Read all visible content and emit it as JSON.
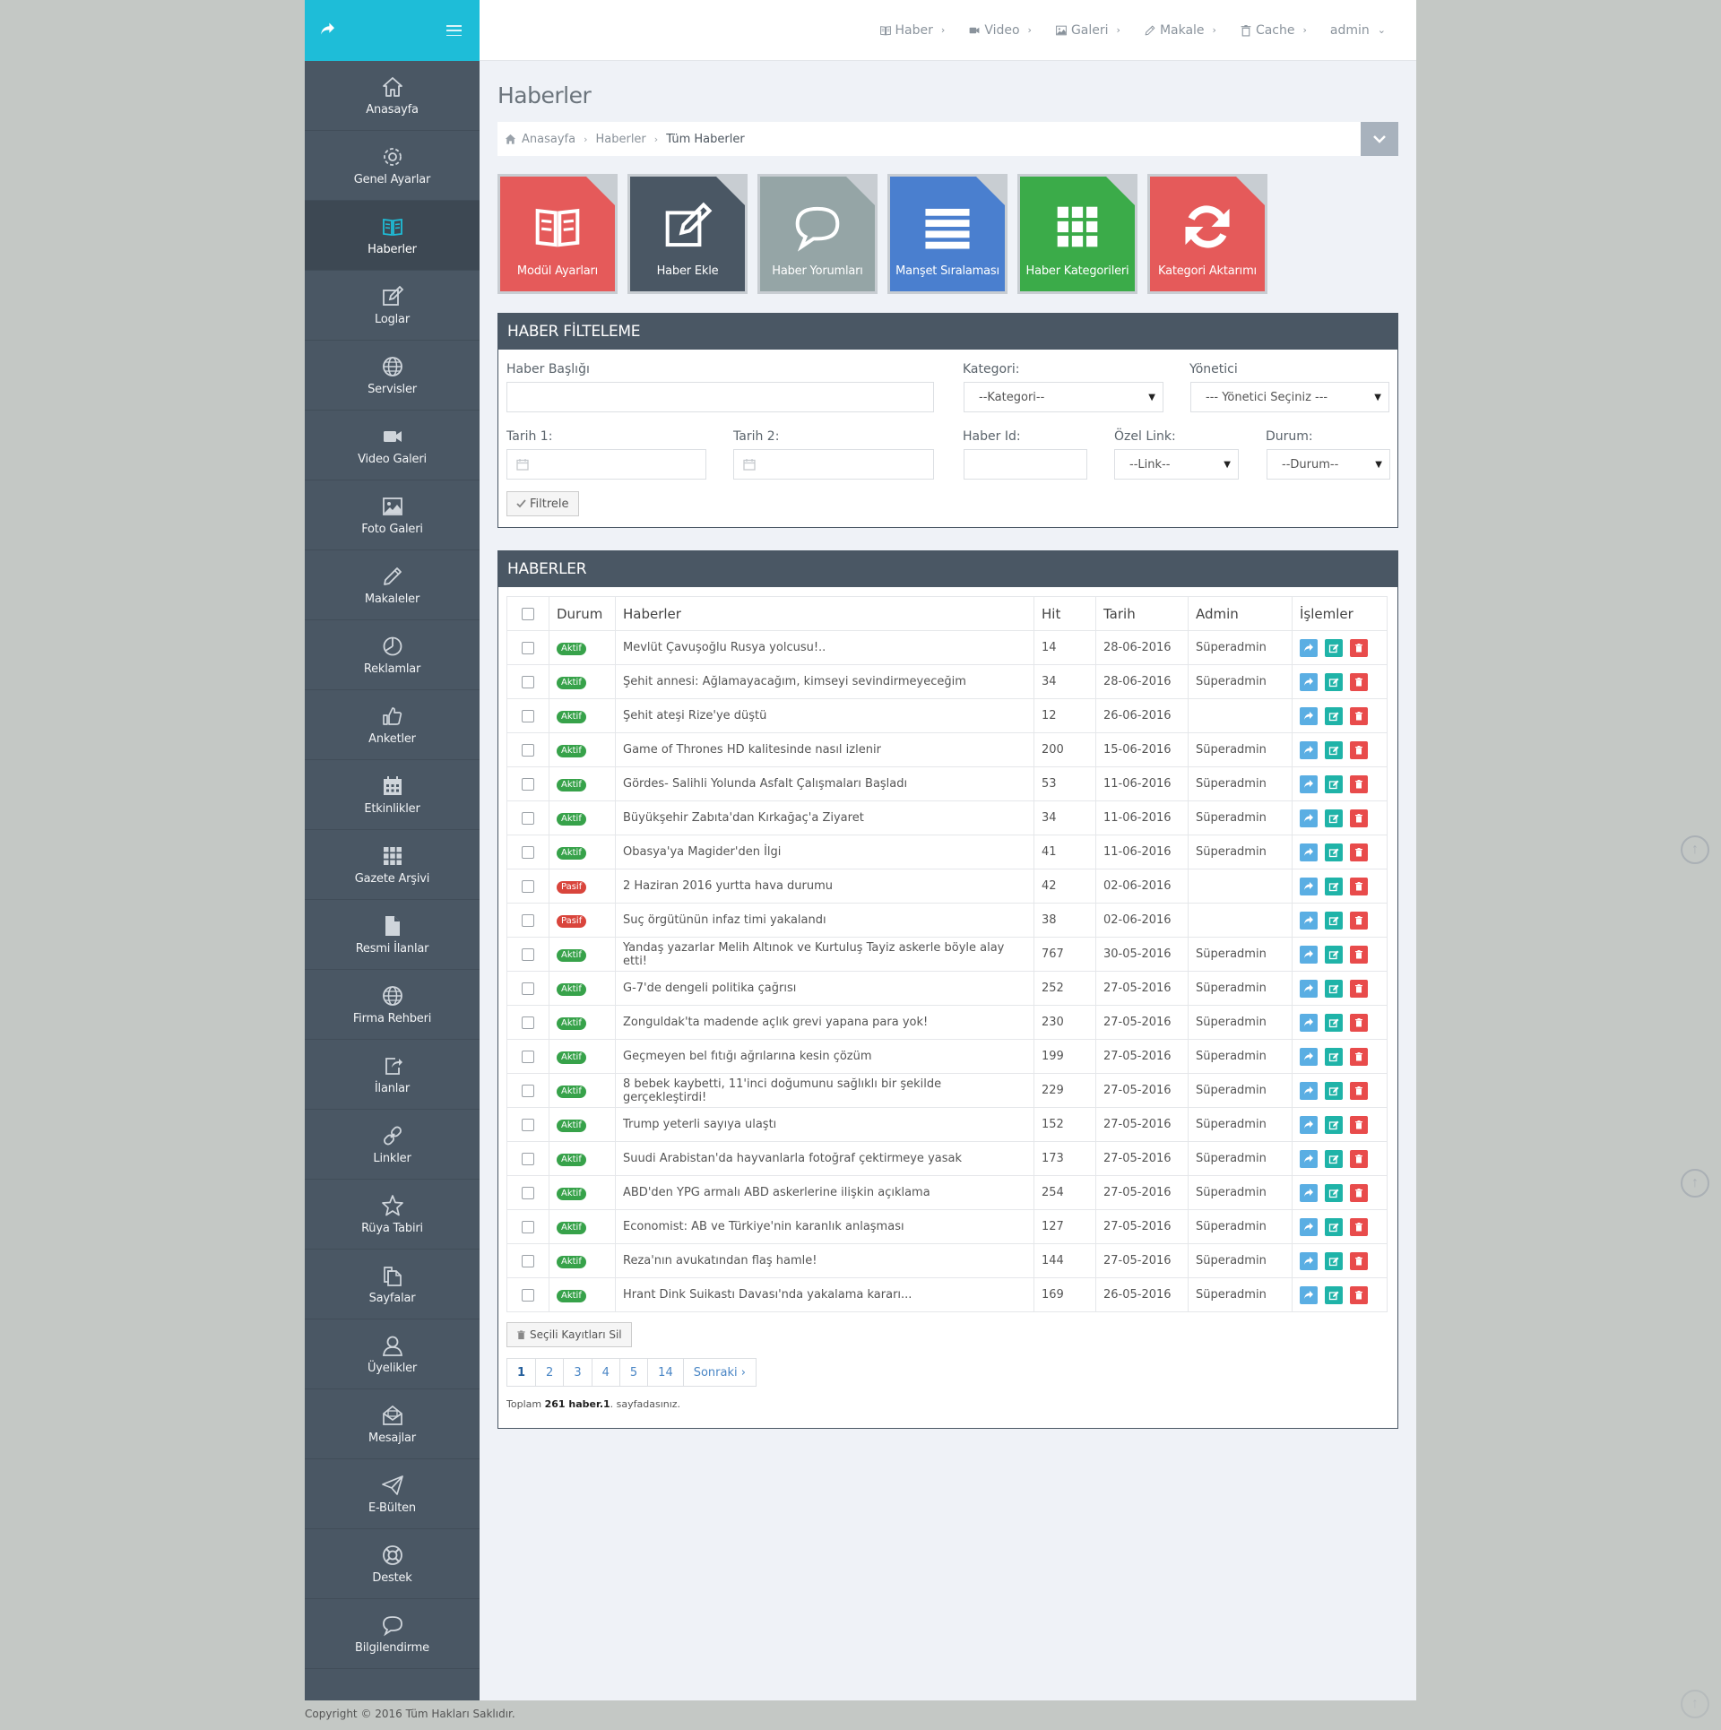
{
  "sidebar": {
    "items": [
      {
        "label": "Anasayfa",
        "icon": "home-icon"
      },
      {
        "label": "Genel Ayarlar",
        "icon": "gear-icon"
      },
      {
        "label": "Haberler",
        "icon": "book-icon"
      },
      {
        "label": "Loglar",
        "icon": "edit-icon"
      },
      {
        "label": "Servisler",
        "icon": "globe-icon"
      },
      {
        "label": "Video Galeri",
        "icon": "video-icon"
      },
      {
        "label": "Foto Galeri",
        "icon": "picture-icon"
      },
      {
        "label": "Makaleler",
        "icon": "pencil-icon"
      },
      {
        "label": "Reklamlar",
        "icon": "pie-chart-icon"
      },
      {
        "label": "Anketler",
        "icon": "thumbs-up-icon"
      },
      {
        "label": "Etkinlikler",
        "icon": "calendar-icon"
      },
      {
        "label": "Gazete Arşivi",
        "icon": "grid-icon"
      },
      {
        "label": "Resmi İlanlar",
        "icon": "file-icon"
      },
      {
        "label": "Firma Rehberi",
        "icon": "globe-icon"
      },
      {
        "label": "İlanlar",
        "icon": "share-square-icon"
      },
      {
        "label": "Linkler",
        "icon": "link-icon"
      },
      {
        "label": "Rüya Tabiri",
        "icon": "star-icon"
      },
      {
        "label": "Sayfalar",
        "icon": "copy-icon"
      },
      {
        "label": "Üyelikler",
        "icon": "user-icon"
      },
      {
        "label": "Mesajlar",
        "icon": "envelope-icon"
      },
      {
        "label": "E-Bülten",
        "icon": "paper-plane-icon"
      },
      {
        "label": "Destek",
        "icon": "life-ring-icon"
      },
      {
        "label": "Bilgilendirme",
        "icon": "comment-icon"
      }
    ],
    "active_index": 2
  },
  "topnav": {
    "items": [
      {
        "label": "Haber",
        "icon": "book-icon"
      },
      {
        "label": "Video",
        "icon": "video-icon"
      },
      {
        "label": "Galeri",
        "icon": "picture-icon"
      },
      {
        "label": "Makale",
        "icon": "pencil-icon"
      },
      {
        "label": "Cache",
        "icon": "trash-icon"
      }
    ],
    "user": "admin"
  },
  "page": {
    "title": "Haberler",
    "breadcrumb": [
      "Anasayfa",
      "Haberler",
      "Tüm Haberler"
    ]
  },
  "tiles": [
    {
      "label": "Modül Ayarları",
      "color": "#e55a5a",
      "icon": "book-icon"
    },
    {
      "label": "Haber Ekle",
      "color": "#4a5764",
      "icon": "edit-icon"
    },
    {
      "label": "Haber Yorumları",
      "color": "#95a5a6",
      "icon": "comment-icon"
    },
    {
      "label": "Manşet Sıralaması",
      "color": "#4a7fcf",
      "icon": "list-icon"
    },
    {
      "label": "Haber Kategorileri",
      "color": "#3bab49",
      "icon": "grid-icon"
    },
    {
      "label": "Kategori Aktarımı",
      "color": "#e55a5a",
      "icon": "refresh-icon"
    }
  ],
  "filter": {
    "title": "HABER FİLTELEME",
    "haber_basligi_label": "Haber Başlığı",
    "kategori_label": "Kategori:",
    "kategori_value": "--Kategori--",
    "yonetici_label": "Yönetici",
    "yonetici_value": "--- Yönetici Seçiniz ---",
    "tarih1_label": "Tarih 1:",
    "tarih2_label": "Tarih 2:",
    "haber_id_label": "Haber Id:",
    "ozel_link_label": "Özel Link:",
    "ozel_link_value": "--Link--",
    "durum_label": "Durum:",
    "durum_value": "--Durum--",
    "button": "Filtrele"
  },
  "list": {
    "title": "HABERLER",
    "columns": [
      "Durum",
      "Haberler",
      "Hit",
      "Tarih",
      "Admin",
      "İşlemler"
    ],
    "rows": [
      {
        "status": "Aktif",
        "title": "Mevlüt Çavuşoğlu Rusya yolcusu!..",
        "hit": "14",
        "date": "28-06-2016",
        "admin": "Süperadmin"
      },
      {
        "status": "Aktif",
        "title": "Şehit annesi: Ağlamayacağım, kimseyi sevindirmeyeceğim",
        "hit": "34",
        "date": "28-06-2016",
        "admin": "Süperadmin"
      },
      {
        "status": "Aktif",
        "title": "Şehit ateşi Rize'ye düştü",
        "hit": "12",
        "date": "26-06-2016",
        "admin": ""
      },
      {
        "status": "Aktif",
        "title": "Game of Thrones HD kalitesinde nasıl izlenir",
        "hit": "200",
        "date": "15-06-2016",
        "admin": "Süperadmin"
      },
      {
        "status": "Aktif",
        "title": "Gördes- Salihli Yolunda Asfalt Çalışmaları Başladı",
        "hit": "53",
        "date": "11-06-2016",
        "admin": "Süperadmin"
      },
      {
        "status": "Aktif",
        "title": "Büyükşehir Zabıta'dan Kırkağaç'a Ziyaret",
        "hit": "34",
        "date": "11-06-2016",
        "admin": "Süperadmin"
      },
      {
        "status": "Aktif",
        "title": "Obasya'ya Magider'den İlgi",
        "hit": "41",
        "date": "11-06-2016",
        "admin": "Süperadmin"
      },
      {
        "status": "Pasif",
        "title": "2 Haziran 2016 yurtta hava durumu",
        "hit": "42",
        "date": "02-06-2016",
        "admin": ""
      },
      {
        "status": "Pasif",
        "title": "Suç örgütünün infaz timi yakalandı",
        "hit": "38",
        "date": "02-06-2016",
        "admin": ""
      },
      {
        "status": "Aktif",
        "title": "Yandaş yazarlar Melih Altınok ve Kurtuluş Tayiz askerle böyle alay etti!",
        "hit": "767",
        "date": "30-05-2016",
        "admin": "Süperadmin"
      },
      {
        "status": "Aktif",
        "title": "G-7'de dengeli politika çağrısı",
        "hit": "252",
        "date": "27-05-2016",
        "admin": "Süperadmin"
      },
      {
        "status": "Aktif",
        "title": "Zonguldak'ta madende açlık grevi yapana para yok!",
        "hit": "230",
        "date": "27-05-2016",
        "admin": "Süperadmin"
      },
      {
        "status": "Aktif",
        "title": "Geçmeyen bel fıtığı ağrılarına kesin çözüm",
        "hit": "199",
        "date": "27-05-2016",
        "admin": "Süperadmin"
      },
      {
        "status": "Aktif",
        "title": "8 bebek kaybetti, 11'inci doğumunu sağlıklı bir şekilde gerçekleştirdi!",
        "hit": "229",
        "date": "27-05-2016",
        "admin": "Süperadmin"
      },
      {
        "status": "Aktif",
        "title": "Trump yeterli sayıya ulaştı",
        "hit": "152",
        "date": "27-05-2016",
        "admin": "Süperadmin"
      },
      {
        "status": "Aktif",
        "title": "Suudi Arabistan'da hayvanlarla fotoğraf çektirmeye yasak",
        "hit": "173",
        "date": "27-05-2016",
        "admin": "Süperadmin"
      },
      {
        "status": "Aktif",
        "title": "ABD'den YPG armalı ABD askerlerine ilişkin açıklama",
        "hit": "254",
        "date": "27-05-2016",
        "admin": "Süperadmin"
      },
      {
        "status": "Aktif",
        "title": "Economist: AB ve Türkiye'nin karanlık anlaşması",
        "hit": "127",
        "date": "27-05-2016",
        "admin": "Süperadmin"
      },
      {
        "status": "Aktif",
        "title": "Reza'nın avukatından flaş hamle!",
        "hit": "144",
        "date": "27-05-2016",
        "admin": "Süperadmin"
      },
      {
        "status": "Aktif",
        "title": "Hrant Dink Suikastı Davası'nda yakalama kararı...",
        "hit": "169",
        "date": "26-05-2016",
        "admin": "Süperadmin"
      }
    ],
    "delete_selected": "Seçili Kayıtları Sil",
    "pages": [
      "1",
      "2",
      "3",
      "4",
      "5",
      "14",
      "Sonraki  ›"
    ],
    "current_page": "1",
    "total_prefix": "Toplam",
    "total_count": "261 haber.",
    "total_page": "1",
    "total_suffix": ". sayfadasınız."
  },
  "footer": {
    "copyright": "Copyright © 2016 Tüm Hakları Saklıdır."
  }
}
